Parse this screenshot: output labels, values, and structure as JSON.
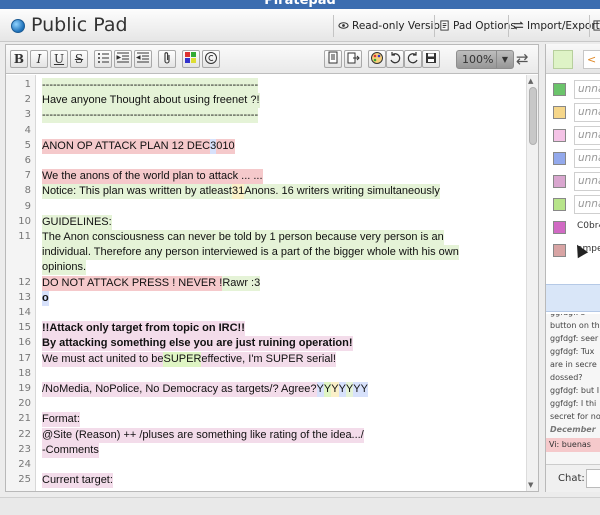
{
  "window_title": "Piratepad",
  "pad_title": "Public Pad",
  "header_buttons": {
    "readonly": "Read-only Version",
    "options": "Pad Options",
    "import_export": "Import/Export"
  },
  "toolbar": {
    "bold": "B",
    "italic": "I",
    "underline": "U",
    "strike": "S",
    "zoom": "100%"
  },
  "side_header": {
    "name_value": "< e"
  },
  "users": [
    {
      "color": "#6bc46b",
      "name": "unna",
      "placeholder": true
    },
    {
      "color": "#f5d68a",
      "name": "unna",
      "placeholder": true
    },
    {
      "color": "#f4c3e6",
      "name": "unna",
      "placeholder": true
    },
    {
      "color": "#93a9ec",
      "name": "unna",
      "placeholder": true
    },
    {
      "color": "#d9a6cf",
      "name": "unna",
      "placeholder": true
    },
    {
      "color": "#b7e48a",
      "name": "unna",
      "placeholder": true
    },
    {
      "color": "#d16ac4",
      "name": "C0br4",
      "placeholder": false
    },
    {
      "color": "#d8a4a4",
      "name": "ampe",
      "placeholder": false
    }
  ],
  "chat": {
    "messages": [
      "ggfdgf: s",
      "button on th",
      "ggfdgf: seer",
      "ggfdgf: Tux",
      "are in secre",
      "dossed?",
      "ggfdgf: but I",
      "ggfdgf: I thi",
      "secret for no",
      "December",
      "Vi: buenas"
    ],
    "label": "Chat:"
  },
  "line_numbers": [
    "1",
    "2",
    "3",
    "4",
    "5",
    "6",
    "7",
    "8",
    "9",
    "10",
    "11",
    "",
    "",
    "12",
    "13",
    "14",
    "15",
    "16",
    "17",
    "18",
    "19",
    "20",
    "21",
    "22",
    "23",
    "24",
    "25"
  ],
  "lines": [
    [
      {
        "t": "-----------------------------------------------------------",
        "c": "c-green"
      }
    ],
    [
      {
        "t": "Have anyone Thought about using freenet ?!",
        "c": "c-green"
      }
    ],
    [
      {
        "t": "-----------------------------------------------------------",
        "c": "c-green"
      }
    ],
    [],
    [
      {
        "t": "ANON OP ATTACK PLAN              12 DEC ",
        "c": "c-red"
      },
      {
        "t": "3",
        "c": "c-lav"
      },
      {
        "t": "010",
        "c": "c-red"
      }
    ],
    [],
    [
      {
        "t": "We the anons of the world plan to attack ... ...",
        "c": "c-red"
      }
    ],
    [
      {
        "t": "Notice: This plan was written by atleast ",
        "c": "c-green"
      },
      {
        "t": "31",
        "c": "c-yellow"
      },
      {
        "t": " Anons. 16 writers writing simultaneously",
        "c": "c-green"
      }
    ],
    [],
    [
      {
        "t": "GUIDELINES:",
        "c": "c-green"
      }
    ],
    [
      {
        "t": "The Anon consciousness can never be told by 1 person because very person is an",
        "c": "c-green"
      }
    ],
    [
      {
        "t": "individual. Therefore any person interviewed is a part of the bigger whole with his own",
        "c": "c-green"
      }
    ],
    [
      {
        "t": "opinions.",
        "c": "c-green"
      }
    ],
    [
      {
        "t": "DO NOT ATTACK PRESS ! NEVER !",
        "c": "c-red"
      },
      {
        "t": "Rawr :3",
        "c": "c-green"
      }
    ],
    [
      {
        "t": "o",
        "c": "c-lav b"
      }
    ],
    [],
    [
      {
        "t": "!!Attack only target from topic on IRC!!",
        "c": "c-pink b"
      }
    ],
    [
      {
        "t": "By attacking something else you are just ruining operation!",
        "c": "c-pink b"
      }
    ],
    [
      {
        "t": "We must act united to be ",
        "c": "c-pink"
      },
      {
        "t": "SUPER",
        "c": "c-lime"
      },
      {
        "t": " effective, I'm SUPER serial!",
        "c": "c-pink"
      }
    ],
    [],
    [
      {
        "t": "/NoMedia, NoPolice, No Democracy as targets/? Agree?",
        "c": "c-pink"
      },
      {
        "t": "Y",
        "c": "c-lav"
      },
      {
        "t": " Y",
        "c": "c-lime"
      },
      {
        "t": " Y",
        "c": "c-yellow"
      },
      {
        "t": "Y",
        "c": "c-lav"
      },
      {
        "t": "Y",
        "c": "c-green"
      },
      {
        "t": "YY",
        "c": "c-lav"
      }
    ],
    [],
    [
      {
        "t": "Format:",
        "c": "c-pink"
      }
    ],
    [
      {
        "t": "@Site (Reason) ++ /pluses are something like rating of the idea.../",
        "c": "c-pink"
      }
    ],
    [
      {
        "t": "-Comments",
        "c": "c-pink"
      }
    ],
    [],
    [
      {
        "t": "Current target:",
        "c": "c-pink"
      }
    ]
  ]
}
